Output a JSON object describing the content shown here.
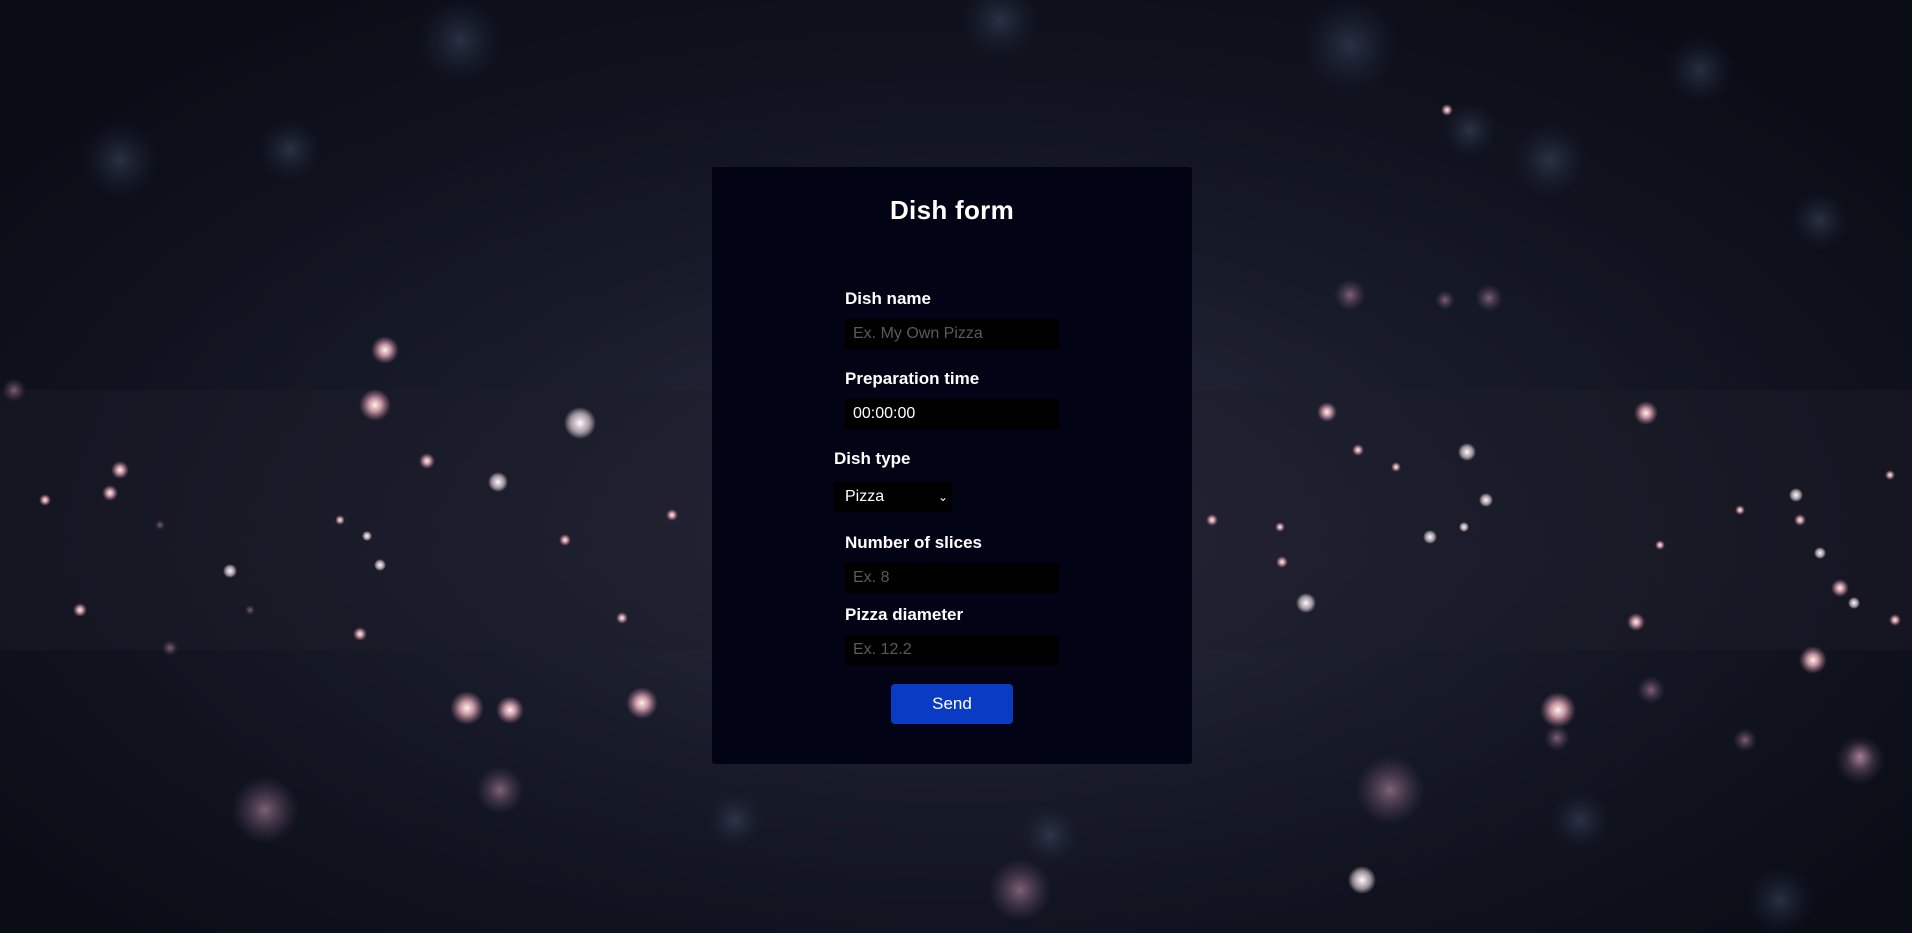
{
  "form": {
    "title": "Dish form",
    "dish_name": {
      "label": "Dish name",
      "placeholder": "Ex. My Own Pizza"
    },
    "preparation_time": {
      "label": "Preparation time",
      "value": "00:00:00"
    },
    "dish_type": {
      "label": "Dish type",
      "selected": "Pizza"
    },
    "slices": {
      "label": "Number of slices",
      "placeholder": "Ex. 8"
    },
    "diameter": {
      "label": "Pizza diameter",
      "placeholder": "Ex. 12.2"
    },
    "send_label": "Send"
  },
  "colors": {
    "card_bg": "#020416",
    "button_bg": "#0a3bc4",
    "field_bg": "#000000",
    "text": "#ffffff"
  },
  "icons": {
    "dropdown": "chevron-down-icon"
  }
}
